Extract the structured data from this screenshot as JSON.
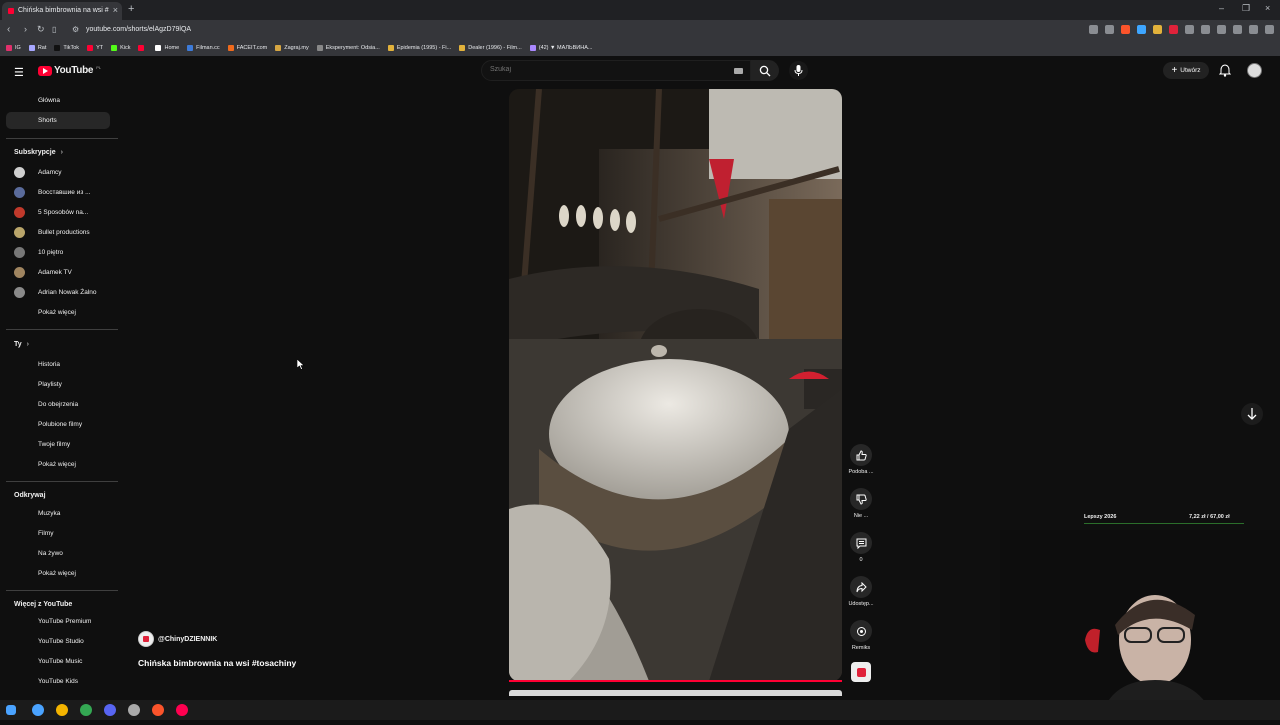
{
  "browser": {
    "tab_title": "Chińska bimbrownia na wsi #",
    "url": "youtube.com/shorts/elAgzD79lQA",
    "bookmarks": [
      "IG",
      "Rat",
      "TikTok",
      "YT",
      "Kick",
      "",
      "Home",
      "Filman.cc",
      "FACEIT.com",
      "Zagraj.my",
      "Eksperyment: Odsia...",
      "Epidemia (1995) - Fi...",
      "Dealer (1996) - Film...",
      "(42) ▼ МАЛЬВИНА..."
    ],
    "bookmark_colors": [
      "#e1306c",
      "#a7a7ff",
      "#111111",
      "#ff0033",
      "#53fc18",
      "#ff0033",
      "#ffffff",
      "#3d7bd9",
      "#f06a1c",
      "#d6a642",
      "#888888",
      "#e2b23b",
      "#e2b23b",
      "#aa88ff"
    ]
  },
  "header": {
    "logo_text": "YouTube",
    "country_code": "PL",
    "search_placeholder": "Szukaj",
    "create_label": "Utwórz"
  },
  "sidebar": {
    "main": [
      {
        "label": "Główna",
        "icon": "home-icon"
      },
      {
        "label": "Shorts",
        "icon": "shorts-icon",
        "active": true
      }
    ],
    "subscriptions_header": "Subskrypcje",
    "subscriptions": [
      {
        "label": "Adamcy",
        "color": "#cfcfcf"
      },
      {
        "label": "Восставшие из ...",
        "color": "#5a6b9b"
      },
      {
        "label": "5 Sposobów na...",
        "color": "#c0392b"
      },
      {
        "label": "Bullet productions",
        "color": "#b9a56a"
      },
      {
        "label": "10 piętro",
        "color": "#777777"
      },
      {
        "label": "Adamek TV",
        "color": "#a08560"
      },
      {
        "label": "Adrian Nowak Żalno",
        "color": "#8a8a8a"
      }
    ],
    "subs_more": "Pokaż więcej",
    "you_header": "Ty",
    "you_items": [
      {
        "label": "Historia",
        "icon": "history-icon"
      },
      {
        "label": "Playlisty",
        "icon": "playlist-icon"
      },
      {
        "label": "Do obejrzenia",
        "icon": "watch-later-icon"
      },
      {
        "label": "Polubione filmy",
        "icon": "like-icon"
      },
      {
        "label": "Twoje filmy",
        "icon": "your-videos-icon"
      }
    ],
    "you_more": "Pokaż więcej",
    "explore_header": "Odkrywaj",
    "explore_items": [
      {
        "label": "Muzyka",
        "icon": "music-icon"
      },
      {
        "label": "Filmy",
        "icon": "film-icon"
      },
      {
        "label": "Na żywo",
        "icon": "live-icon"
      }
    ],
    "explore_more": "Pokaż więcej",
    "more_header": "Więcej z YouTube",
    "more_items": [
      {
        "label": "YouTube Premium"
      },
      {
        "label": "YouTube Studio"
      },
      {
        "label": "YouTube Music"
      },
      {
        "label": "YouTube Kids"
      }
    ]
  },
  "short": {
    "channel": "@ChinyDZIENNIK",
    "title": "Chińska bimbrownia na wsi #tosachiny",
    "actions": {
      "like": "Podoba ...",
      "dislike": "Nie ...",
      "comments": "0",
      "share": "Udostęp...",
      "remix": "Remiks"
    }
  },
  "stream_overlay": {
    "left_text": "Lepszy 2026",
    "right_text": "7,22 zł / 67,00 zł"
  },
  "taskbar": {
    "app_colors": [
      "#4aa3ff",
      "#f4b400",
      "#34a853",
      "#5865f2",
      "#aaaaaa",
      "#fb542b",
      "#ff0050"
    ]
  }
}
